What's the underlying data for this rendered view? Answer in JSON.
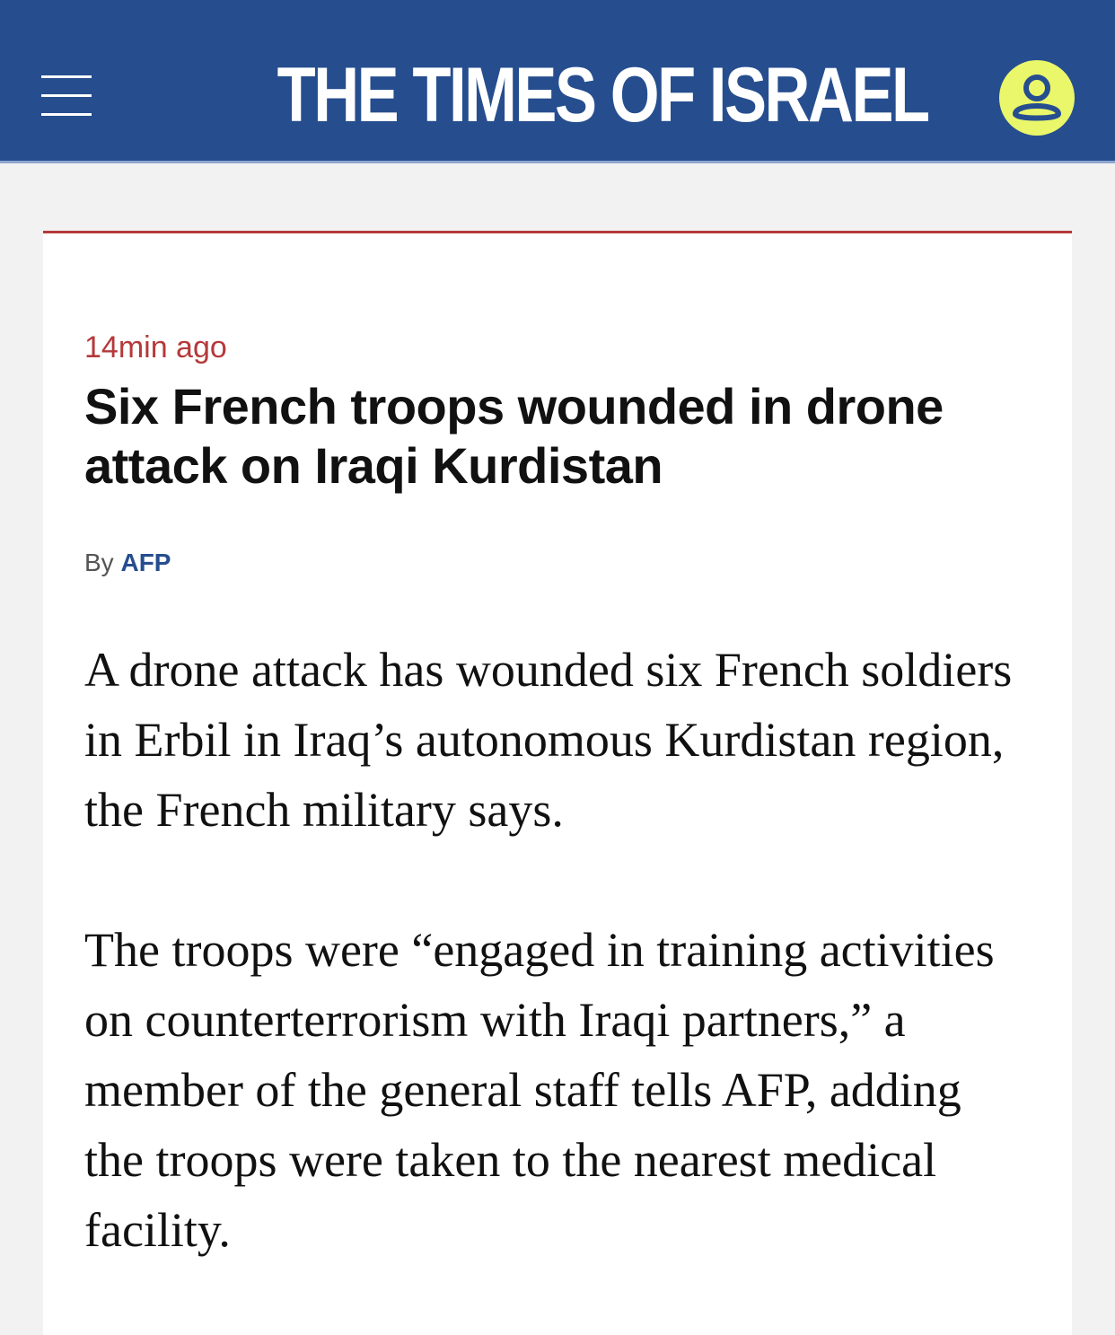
{
  "header": {
    "logo_text": "THE TIMES OF ISRAEL",
    "menu_icon": "hamburger-menu-icon",
    "user_icon": "user-account-icon",
    "background_color": "#264e8f",
    "user_icon_color": "#eaf76a"
  },
  "article": {
    "timestamp": "14min ago",
    "headline": "Six French troops wounded in drone attack on Iraqi Kurdistan",
    "byline_prefix": "By",
    "byline_author": "AFP",
    "paragraphs": [
      "A drone attack has wounded six French soldiers in Erbil in Iraq’s autonomous Kurdistan region, the French military says.",
      "The troops were “engaged in training activities on counterterrorism with Iraqi partners,” a member of the general staff tells AFP, adding the troops were taken to the nearest medical facility."
    ],
    "accent_color": "#b5393a"
  }
}
